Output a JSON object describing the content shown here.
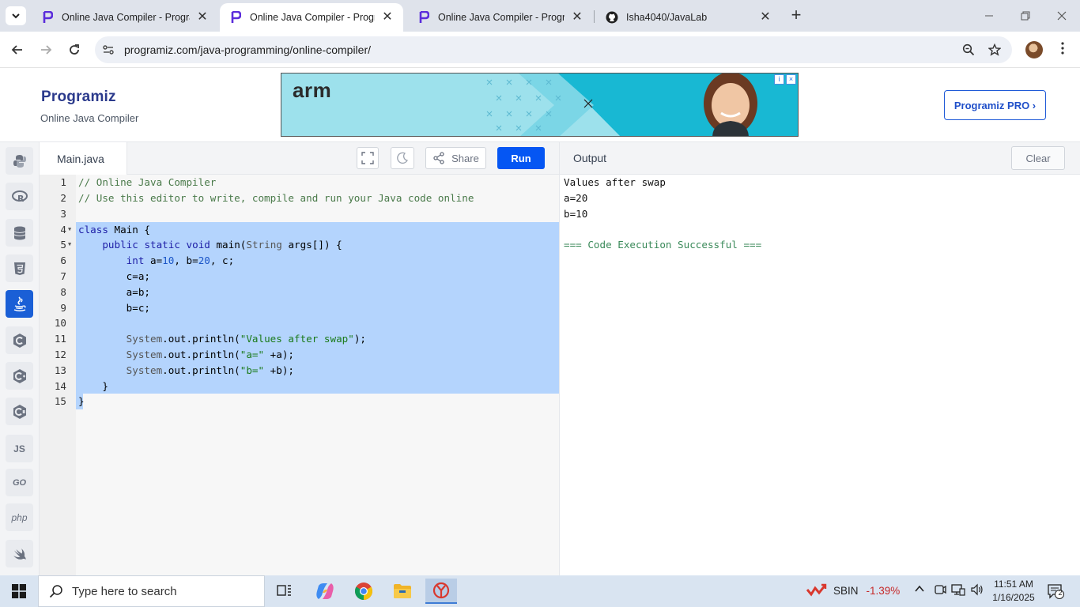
{
  "browser": {
    "tabs": [
      {
        "title": "Online Java Compiler - Progra",
        "active": false
      },
      {
        "title": "Online Java Compiler - Progra",
        "active": true
      },
      {
        "title": "Online Java Compiler - Progra",
        "active": false
      },
      {
        "title": "Isha4040/JavaLab",
        "active": false
      }
    ],
    "url": "programiz.com/java-programming/online-compiler/",
    "close_glyph": "✕",
    "new_tab_glyph": "+"
  },
  "site": {
    "logo": "Programiz",
    "subtitle": "Online Java Compiler",
    "ad_brand": "arm",
    "pro_button": "Programiz PRO ›"
  },
  "editor": {
    "filename": "Main.java",
    "share_label": "Share",
    "run_label": "Run",
    "selected_lines": [
      4,
      5,
      6,
      7,
      8,
      9,
      10,
      11,
      12,
      13,
      14,
      15
    ],
    "folded_markers": [
      4,
      5
    ],
    "lines": [
      {
        "num": "1",
        "text": "// Online Java Compiler"
      },
      {
        "num": "2",
        "text": "// Use this editor to write, compile and run your Java code online"
      },
      {
        "num": "3",
        "text": ""
      },
      {
        "num": "4",
        "text": "class Main {"
      },
      {
        "num": "5",
        "text": "    public static void main(String args[]) {"
      },
      {
        "num": "6",
        "text": "        int a=10, b=20, c;"
      },
      {
        "num": "7",
        "text": "        c=a;"
      },
      {
        "num": "8",
        "text": "        a=b;"
      },
      {
        "num": "9",
        "text": "        b=c;"
      },
      {
        "num": "10",
        "text": ""
      },
      {
        "num": "11",
        "text": "        System.out.println(\"Values after swap\");"
      },
      {
        "num": "12",
        "text": "        System.out.println(\"a=\" +a);"
      },
      {
        "num": "13",
        "text": "        System.out.println(\"b=\" +b);"
      },
      {
        "num": "14",
        "text": "    }"
      },
      {
        "num": "15",
        "text": "}"
      }
    ]
  },
  "output": {
    "title": "Output",
    "clear_label": "Clear",
    "lines": [
      "Values after swap",
      "a=20",
      "b=10",
      "",
      "=== Code Execution Successful ==="
    ]
  },
  "rail": {
    "items": [
      "python-icon",
      "r-icon",
      "sql-icon",
      "html-icon",
      "java-icon",
      "c-icon",
      "cpp-icon",
      "csharp-icon",
      "JS",
      "GO",
      "php",
      "swift-icon"
    ],
    "active_index": 4
  },
  "taskbar": {
    "search_placeholder": "Type here to search",
    "stock_name": "SBIN",
    "stock_change": "-1.39%",
    "time": "11:51 AM",
    "date": "1/16/2025",
    "notification_count": "2"
  },
  "colors": {
    "accent": "#0556f3",
    "selection": "#b4d4fd",
    "success_text": "#3b8a5a",
    "stock_down": "#c62828"
  }
}
